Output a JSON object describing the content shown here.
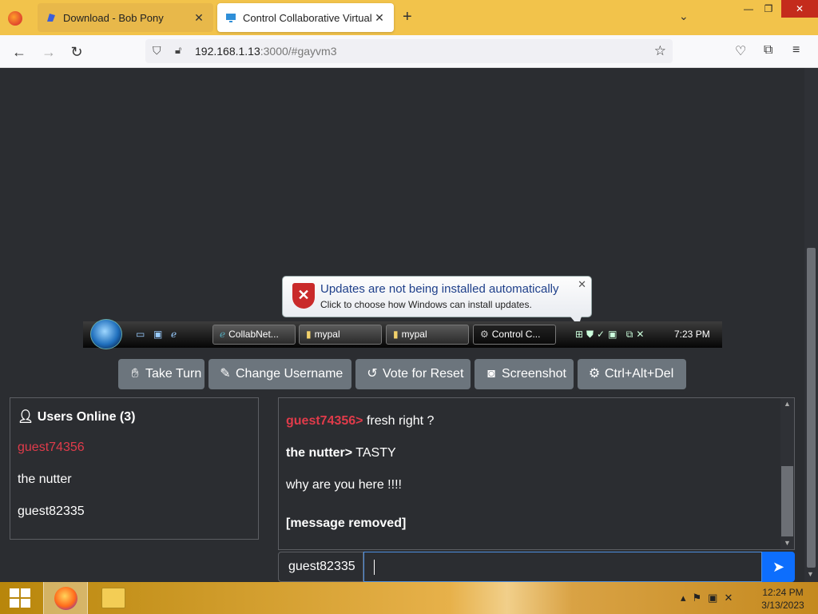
{
  "browser": {
    "tabs": [
      {
        "label": "Download - Bob Pony",
        "favicon": "bobpony-favicon"
      },
      {
        "label": "Control Collaborative Virtual M",
        "favicon": "monitor-favicon"
      }
    ],
    "url_host": "192.168.1.13",
    "url_rest": ":3000/#gayvm3"
  },
  "vm": {
    "balloon": {
      "title": "Updates are not being installed automatically",
      "subtitle": "Click to choose how Windows can install updates."
    },
    "taskbar_buttons": [
      "CollabNet...",
      "mypal",
      "mypal",
      "Control C..."
    ],
    "clock": "7:23 PM"
  },
  "controls": {
    "take_turn": "Take Turn",
    "change_username": "Change Username",
    "vote_reset": "Vote for Reset",
    "screenshot": "Screenshot",
    "ctrl_alt_del": "Ctrl+Alt+Del"
  },
  "users": {
    "header": "Users Online (3)",
    "list": [
      "guest74356",
      "the nutter",
      "guest82335"
    ],
    "highlight_color": "#e03b4a"
  },
  "chat": {
    "messages": [
      {
        "from": "guest74356>",
        "text": " fresh right ?"
      },
      {
        "from": "the nutter>",
        "text": " TASTY"
      },
      {
        "from": "",
        "text": "why are you here !!!!"
      },
      {
        "from": "",
        "text": "[message removed]"
      }
    ],
    "username": "guest82335",
    "input_value": ""
  },
  "host": {
    "time": "12:24 PM",
    "date": "3/13/2023"
  }
}
